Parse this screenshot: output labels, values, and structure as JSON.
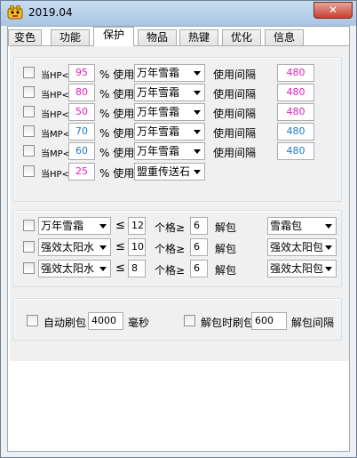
{
  "window": {
    "title": "2019.04",
    "close_label": "✕"
  },
  "colors": {
    "magenta": "#e020c0",
    "blue": "#1e7ac8"
  },
  "tabs": [
    {
      "label": "变色"
    },
    {
      "label": "功能"
    },
    {
      "label": "保护",
      "active": true
    },
    {
      "label": "物品"
    },
    {
      "label": "热键"
    },
    {
      "label": "优化"
    },
    {
      "label": "信息"
    }
  ],
  "protect": {
    "use_label": "% 使用",
    "interval_label": "使用间隔",
    "rows": [
      {
        "cond": "当HP<",
        "value": "95",
        "item": "万年雪霜",
        "interval": "480"
      },
      {
        "cond": "当HP<",
        "value": "80",
        "item": "万年雪霜",
        "interval": "480"
      },
      {
        "cond": "当HP<",
        "value": "50",
        "item": "万年雪霜",
        "interval": "480"
      },
      {
        "cond": "当MP<",
        "value": "70",
        "item": "万年雪霜",
        "interval": "480"
      },
      {
        "cond": "当MP<",
        "value": "60",
        "item": "万年雪霜",
        "interval": "480"
      },
      {
        "cond": "当HP<",
        "value": "25",
        "item": "盟重传送石"
      }
    ]
  },
  "unpack": {
    "le_symbol": "≤",
    "count_label": "个格≥",
    "unpack_label": "解包",
    "rows": [
      {
        "item": "万年雪霜",
        "limit": "12",
        "slots": "6",
        "pack": "雪霜包"
      },
      {
        "item": "强效太阳水",
        "limit": "10",
        "slots": "6",
        "pack": "强效太阳包"
      },
      {
        "item": "强效太阳水",
        "limit": "8",
        "slots": "6",
        "pack": "强效太阳包"
      }
    ]
  },
  "refresh": {
    "auto_label": "自动刷包",
    "auto_value": "4000",
    "ms_label": "毫秒",
    "unpack_refresh_label": "解包时刷包",
    "unpack_refresh_value": "600",
    "unpack_interval_label": "解包间隔"
  }
}
